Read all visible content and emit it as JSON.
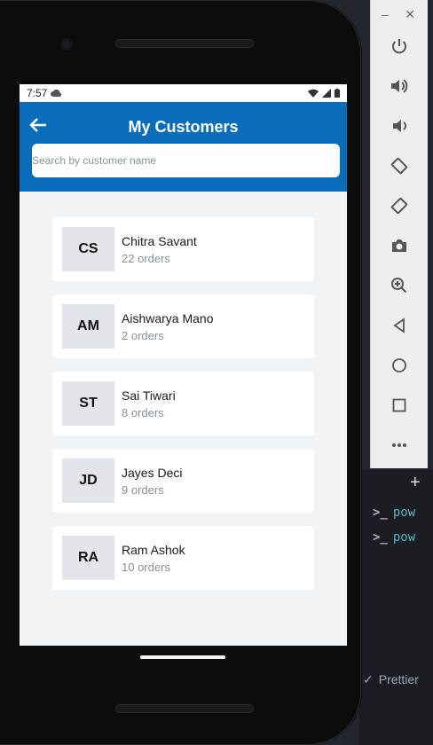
{
  "editor": {
    "terminal_items": [
      "pow",
      "pow"
    ],
    "status_item": "Prettier"
  },
  "emulator_toolbar": {
    "buttons": [
      {
        "name": "power-icon"
      },
      {
        "name": "volume-up-icon"
      },
      {
        "name": "volume-down-icon"
      },
      {
        "name": "rotate-left-icon"
      },
      {
        "name": "rotate-right-icon"
      },
      {
        "name": "camera-icon"
      },
      {
        "name": "zoom-icon"
      },
      {
        "name": "back-triangle-icon"
      },
      {
        "name": "home-circle-icon"
      },
      {
        "name": "overview-square-icon"
      },
      {
        "name": "more-icon"
      }
    ]
  },
  "status_bar": {
    "time": "7:57"
  },
  "header": {
    "title": "My Customers",
    "search_placeholder": "Search by customer name",
    "color": "#0a6dbc"
  },
  "customers": [
    {
      "initials": "CS",
      "name": "Chitra Savant",
      "orders": "22 orders"
    },
    {
      "initials": "AM",
      "name": "Aishwarya Mano",
      "orders": "2 orders"
    },
    {
      "initials": "ST",
      "name": "Sai Tiwari",
      "orders": "8 orders"
    },
    {
      "initials": "JD",
      "name": "Jayes Deci",
      "orders": "9 orders"
    },
    {
      "initials": "RA",
      "name": "Ram Ashok",
      "orders": "10 orders"
    }
  ]
}
